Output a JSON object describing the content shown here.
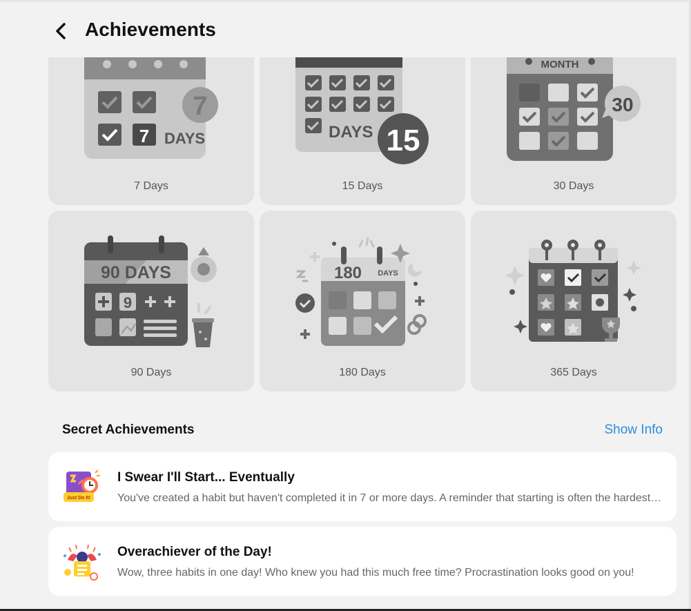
{
  "header": {
    "title": "Achievements",
    "back_icon": "chevron-left-icon"
  },
  "achievements": [
    {
      "label": "7 Days",
      "badge": "7",
      "badge_text": "7",
      "days_text": "DAYS"
    },
    {
      "label": "15 Days",
      "badge": "15",
      "days_text": "DAYS"
    },
    {
      "label": "30 Days",
      "badge": "30",
      "month_text": "MONTH"
    },
    {
      "label": "90 Days",
      "banner": "90 DAYS"
    },
    {
      "label": "180 Days",
      "number": "180",
      "days_text": "DAYS"
    },
    {
      "label": "365 Days"
    }
  ],
  "secret_section": {
    "title": "Secret Achievements",
    "show_info": "Show Info"
  },
  "secret_items": [
    {
      "title": "I Swear I'll Start... Eventually",
      "description": "You've created a habit but haven't completed it in 7 or more days. A reminder that starting is often the hardest part.",
      "icon_text": "Just Do It!"
    },
    {
      "title": "Overachiever of the Day!",
      "description": "Wow, three habits in one day! Who knew you had this much free time? Procrastination looks good on you!"
    }
  ],
  "colors": {
    "background": "#f2f2f2",
    "card": "#e4e4e4",
    "link": "#2b8de0"
  }
}
